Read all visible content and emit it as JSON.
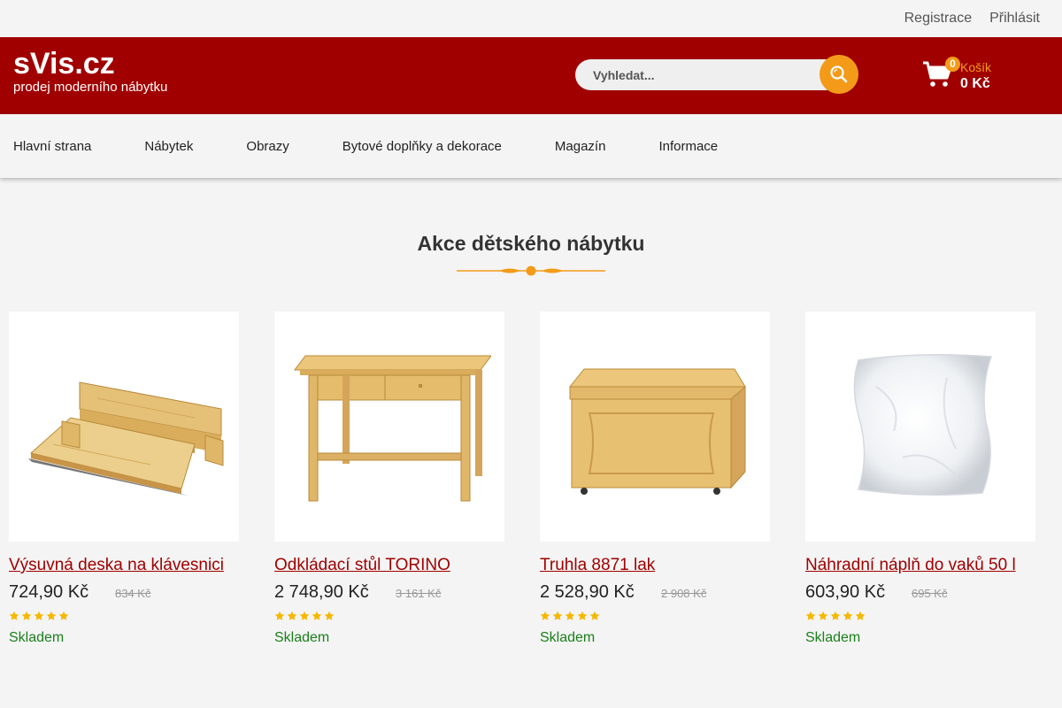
{
  "topbar": {
    "register": "Registrace",
    "login": "Přihlásit"
  },
  "header": {
    "logo_title": "sVis.cz",
    "logo_subtitle": "prodej moderního nábytku",
    "search_placeholder": "Vyhledat...",
    "cart_count": "0",
    "cart_label": "Košík",
    "cart_total": "0 Kč"
  },
  "nav": [
    "Hlavní strana",
    "Nábytek",
    "Obrazy",
    "Bytové doplňky a dekorace",
    "Magazín",
    "Informace"
  ],
  "section": {
    "title": "Akce dětského nábytku"
  },
  "products": [
    {
      "name": "Výsuvná deska na klávesnici",
      "price": "724,90 Kč",
      "old_price": "834 Kč",
      "rating": 5,
      "stock": "Skladem",
      "image": "keyboard-tray"
    },
    {
      "name": "Odkládací stůl TORINO",
      "price": "2 748,90 Kč",
      "old_price": "3 161 Kč",
      "rating": 5,
      "stock": "Skladem",
      "image": "desk"
    },
    {
      "name": "Truhla 8871 lak",
      "price": "2 528,90 Kč",
      "old_price": "2 908 Kč",
      "rating": 5,
      "stock": "Skladem",
      "image": "chest"
    },
    {
      "name": "Náhradní náplň do vaků 50 l",
      "price": "603,90 Kč",
      "old_price": "695 Kč",
      "rating": 5,
      "stock": "Skladem",
      "image": "filling-bag"
    }
  ],
  "colors": {
    "brand": "#a00000",
    "accent": "#f39b18",
    "stock": "#1a7f1a",
    "star": "#f5b800"
  }
}
